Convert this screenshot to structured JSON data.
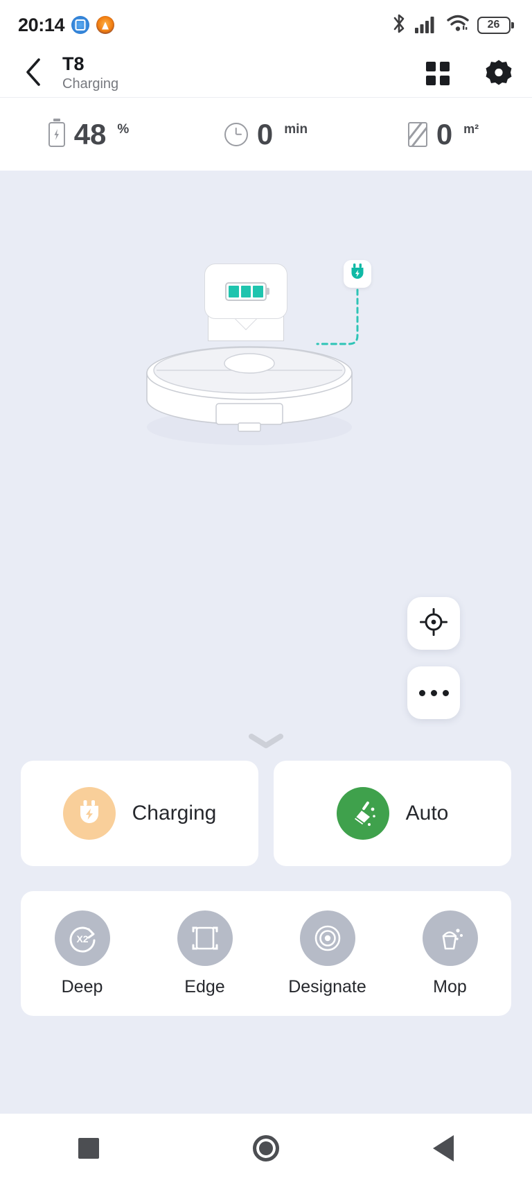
{
  "status_bar": {
    "time": "20:14",
    "app_icons": [
      "messaging-icon",
      "flame-icon"
    ],
    "bluetooth_icon": "bluetooth-icon",
    "signal_icon": "cellular-signal-icon",
    "wifi_icon": "wifi-icon",
    "battery_level": "26"
  },
  "title_bar": {
    "back_icon": "back-chevron-icon",
    "device_name": "T8",
    "device_status": "Charging",
    "grid_icon": "grid-view-icon",
    "settings_icon": "gear-icon"
  },
  "stats": [
    {
      "icon": "battery-icon",
      "value": "48",
      "unit": "%"
    },
    {
      "icon": "clock-icon",
      "value": "0",
      "unit": "min"
    },
    {
      "icon": "area-icon",
      "value": "0",
      "unit": "m²"
    }
  ],
  "map": {
    "robot_icon": "robot-vacuum-icon",
    "dock_icon": "charging-dock-icon",
    "battery_bubble_icon": "battery-level-bubble-icon",
    "battery_bubble_bars": 3,
    "plug_chip_icon": "power-plug-icon",
    "cord_style": "dashed",
    "locate_icon": "locate-crosshair-icon",
    "more_icon": "more-options-icon",
    "drag_handle_icon": "chevron-down-icon"
  },
  "action_cards": [
    {
      "icon": "charging-plug-icon",
      "label": "Charging",
      "color": "#f9cf9a"
    },
    {
      "icon": "broom-icon",
      "label": "Auto",
      "color": "#3fa14c"
    }
  ],
  "modes": [
    {
      "icon": "deep-x2-icon",
      "label": "Deep"
    },
    {
      "icon": "edge-frame-icon",
      "label": "Edge"
    },
    {
      "icon": "designate-target-icon",
      "label": "Designate"
    },
    {
      "icon": "mop-bucket-icon",
      "label": "Mop"
    }
  ],
  "nav_bar": {
    "recents_icon": "recents-square-icon",
    "home_icon": "home-circle-icon",
    "back_icon": "back-triangle-icon"
  },
  "colors": {
    "background": "#e9ecf5",
    "accent_teal": "#1fc4ae",
    "accent_green": "#3fa14c",
    "accent_orange": "#f9cf9a",
    "mode_gray": "#b6bbc7"
  }
}
